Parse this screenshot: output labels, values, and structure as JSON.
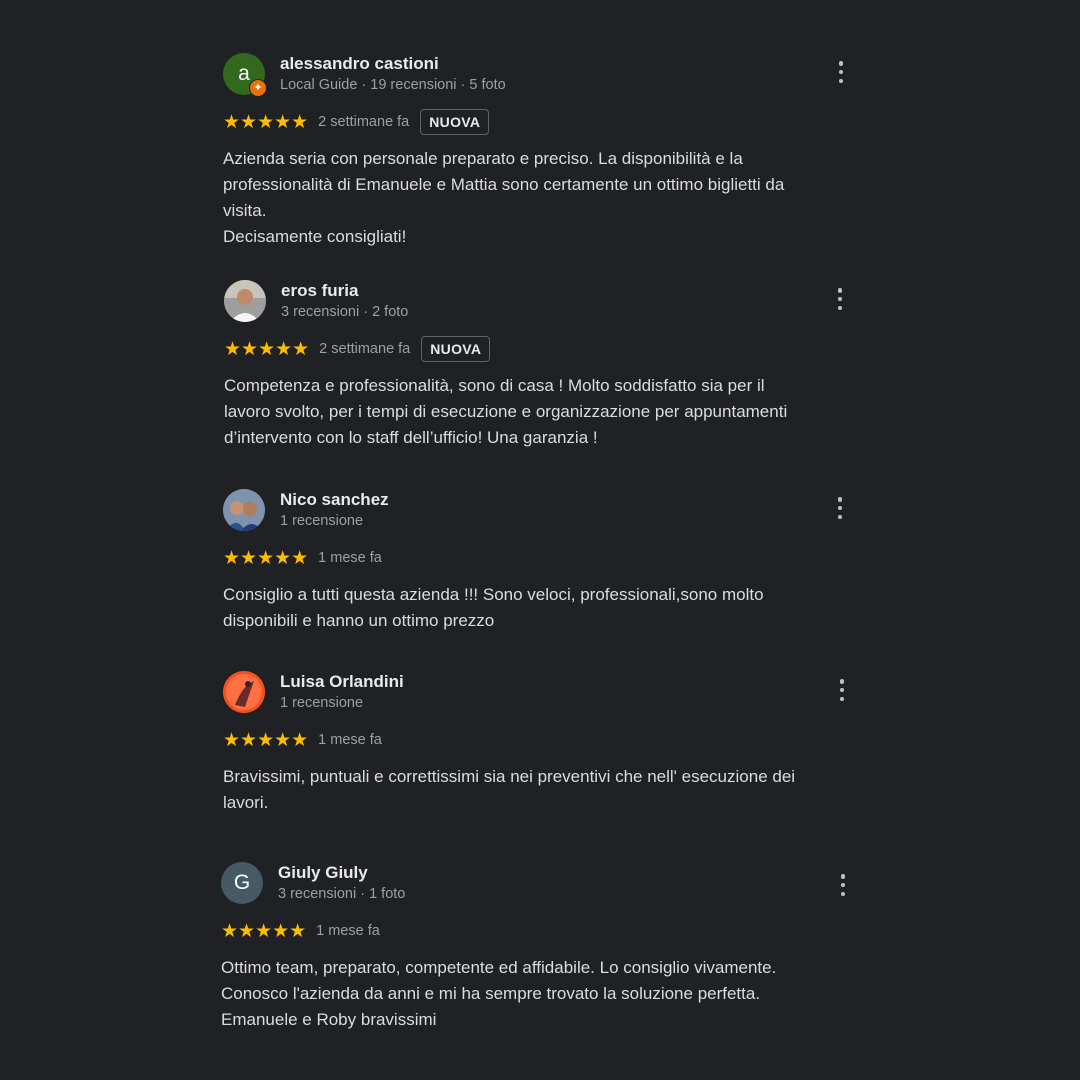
{
  "reviews": [
    {
      "name": "alessandro castioni",
      "meta": "Local Guide · 19 recensioni · 5 foto",
      "avatar_letter": "a",
      "stars": "★★★★★",
      "time": "2 settimane fa",
      "badge": "NUOVA",
      "text": "Azienda seria con personale preparato e preciso. La disponibilità e la\nprofessionalità di Emanuele e Mattia sono certamente un ottimo biglietti da\nvisita.\nDecisamente consigliati!"
    },
    {
      "name": "eros furia",
      "meta": "3 recensioni · 2 foto",
      "stars": "★★★★★",
      "time": "2 settimane fa",
      "badge": "NUOVA",
      "text": "Competenza e professionalità, sono di casa ! Molto soddisfatto sia per il\nlavoro svolto, per i tempi di esecuzione e organizzazione per appuntamenti\nd’intervento con lo staff dell’ufficio! Una garanzia !"
    },
    {
      "name": "Nico sanchez",
      "meta": "1 recensione",
      "stars": "★★★★★",
      "time": "1 mese fa",
      "text": "Consiglio a tutti questa azienda !!! Sono veloci, professionali,sono molto\ndisponibili e hanno un ottimo prezzo"
    },
    {
      "name": "Luisa Orlandini",
      "meta": "1 recensione",
      "stars": "★★★★★",
      "time": "1 mese fa",
      "text": "Bravissimi, puntuali e correttissimi sia nei preventivi che nell' esecuzione dei\nlavori."
    },
    {
      "name": "Giuly Giuly",
      "meta": "3 recensioni · 1 foto",
      "avatar_letter": "G",
      "stars": "★★★★★",
      "time": "1 mese fa",
      "text": "Ottimo team, preparato, competente ed affidabile. Lo consiglio vivamente.\nConosco l'azienda da anni e mi ha sempre trovato la soluzione perfetta.\nEmanuele e Roby bravissimi"
    }
  ],
  "colors": {
    "background": "#202124",
    "star": "#fbbc04",
    "avatar_a": "#33691e",
    "avatar_g": "#455a64",
    "local_guide_badge": "#e8710a"
  },
  "icons": {
    "menu": "more-vert-icon",
    "local_guide": "local-guide-badge-icon"
  }
}
